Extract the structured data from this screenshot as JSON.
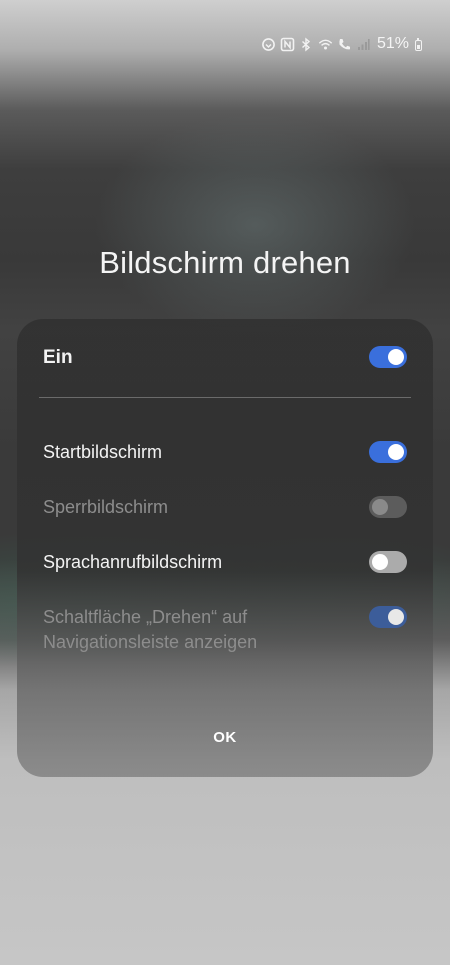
{
  "status_bar": {
    "battery_text": "51%",
    "icons": [
      "data-saver-icon",
      "nfc-icon",
      "bluetooth-icon",
      "wifi-calling-icon",
      "volte-call-icon",
      "signal-icon",
      "battery-icon"
    ]
  },
  "dialog": {
    "title": "Bildschirm drehen",
    "master": {
      "label": "Ein",
      "state": "on"
    },
    "options": [
      {
        "label": "Startbildschirm",
        "state": "on",
        "enabled": true
      },
      {
        "label": "Sperrbildschirm",
        "state": "off",
        "enabled": false
      },
      {
        "label": "Sprachanrufbildschirm",
        "state": "off",
        "enabled": true
      },
      {
        "label": "Schaltfläche „Drehen“ auf Navigationsleiste anzeigen",
        "state": "on",
        "enabled": false
      }
    ],
    "ok_label": "OK"
  },
  "colors": {
    "accent": "#3a6fdc",
    "dialog_background": "#303030",
    "text_primary": "#f3f3f3",
    "text_disabled": "#8d8d8d"
  }
}
